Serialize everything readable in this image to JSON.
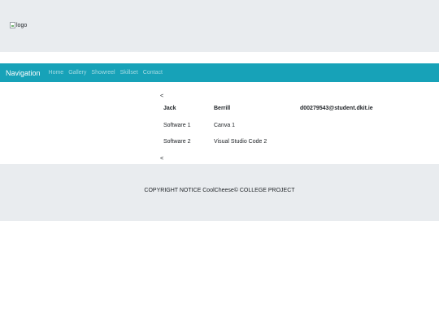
{
  "header": {
    "logo_alt": "logo"
  },
  "navbar": {
    "brand": "Navigation",
    "links": [
      "Home",
      "Gallery",
      "Showreel",
      "Skillset",
      "Contact"
    ]
  },
  "carousel": {
    "prev_symbol": "<",
    "next_symbol": "<"
  },
  "table": {
    "header": [
      "Jack",
      "Berrill",
      "d00279543@student.dkit.ie"
    ],
    "rows": [
      [
        "Software 1",
        "Canva 1"
      ],
      [
        "Software 2",
        "Visual Studio Code 2"
      ]
    ]
  },
  "footer": {
    "copyright": "COPYRIGHT NOTICE CoolCheese© COLLEGE PROJECT"
  }
}
